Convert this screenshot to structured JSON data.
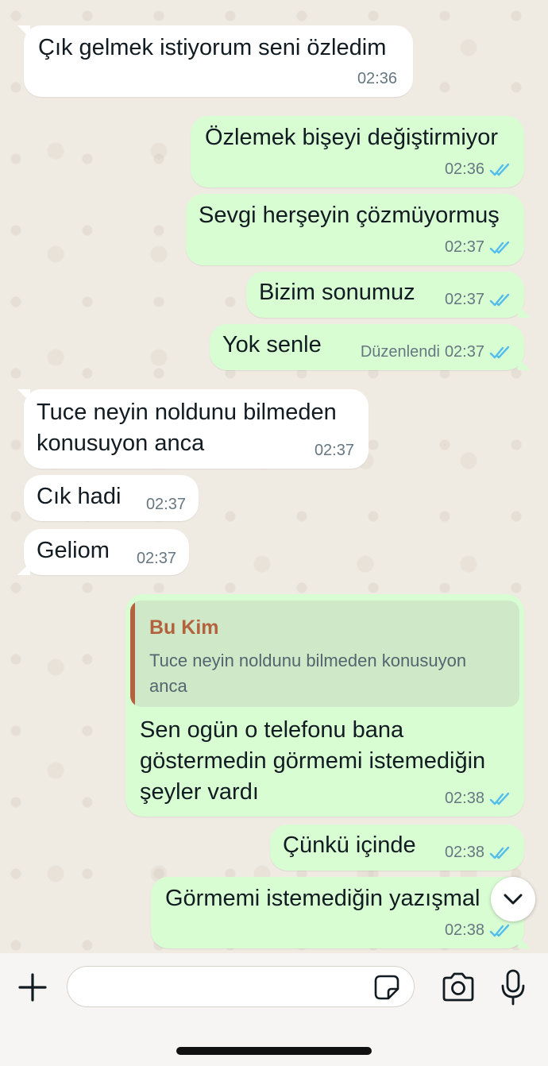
{
  "messages": [
    {
      "text": "Çık gelmek istiyorum seni özledim",
      "time": "02:36"
    },
    {
      "text": "Özlemek bişeyi değiştirmiyor",
      "time": "02:36"
    },
    {
      "text": "Sevgi herşeyin çözmüyormuş",
      "time": "02:37"
    },
    {
      "text": "Bizim sonumuz",
      "time": "02:37"
    },
    {
      "text": "Yok senle",
      "time": "02:37",
      "edited_label": "Düzenlendi"
    },
    {
      "text": "Tuce neyin noldunu bilmeden\nkonusuyon anca",
      "time": "02:37"
    },
    {
      "text": "Cık hadi",
      "time": "02:37"
    },
    {
      "text": "Geliom",
      "time": "02:37"
    },
    {
      "text": "Sen ogün o telefonu bana\ngöstermedin görmemi istemediğin\nşeyler vardı",
      "time": "02:38",
      "reply": {
        "author": "Bu Kim",
        "text": "Tuce neyin noldunu bilmeden konusuyon\nanca"
      }
    },
    {
      "text": "Çünkü içinde",
      "time": "02:38"
    },
    {
      "text": "Görmemi istemediğin yazışmal",
      "time": "02:38"
    }
  ],
  "input": {
    "placeholder": ""
  },
  "icons": {
    "add": "plus-icon",
    "sticker": "sticker-icon",
    "camera": "camera-icon",
    "mic": "microphone-icon",
    "scroll": "chevron-down-icon",
    "read": "double-check-icon"
  },
  "colors": {
    "incoming": "#ffffff",
    "outgoing": "#d9fdd3",
    "read_ticks": "#53bdeb",
    "reply_author": "#b4613d",
    "background": "#efeae2"
  }
}
